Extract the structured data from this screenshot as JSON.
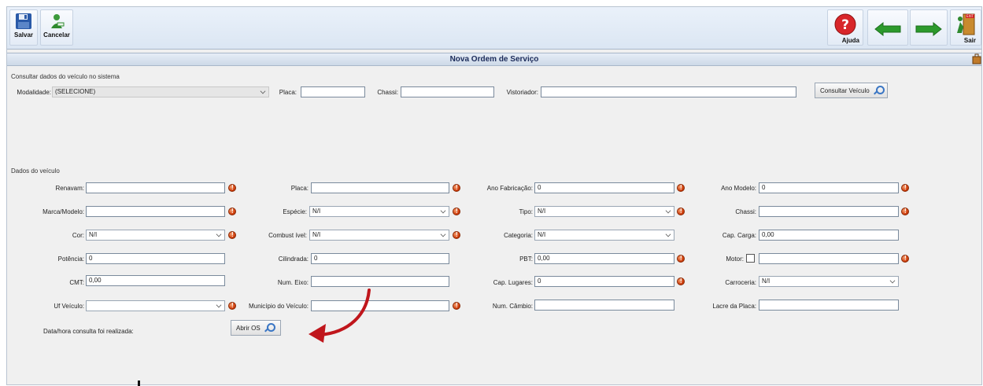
{
  "toolbar": {
    "save_label": "Salvar",
    "cancel_label": "Cancelar",
    "help_label": "Ajuda",
    "exit_label": "Sair",
    "exit_sign": "EXIT"
  },
  "window_title": "Nova Ordem de Serviço",
  "consult": {
    "group_title": "Consultar dados do veículo no sistema",
    "modalidade_label": "Modalidade:",
    "modalidade_value": "(SELECIONE)",
    "placa_label": "Placa:",
    "placa_value": "",
    "chassi_label": "Chassi:",
    "chassi_value": "",
    "vistoriador_label": "Vistoriador:",
    "vistoriador_value": "",
    "button_label": "Consultar Veículo"
  },
  "vehicle": {
    "group_title": "Dados do veículo",
    "renavam_label": "Renavam:",
    "renavam_value": "",
    "placa_label": "Placa:",
    "placa_value": "",
    "ano_fab_label": "Ano Fabricação:",
    "ano_fab_value": "0",
    "ano_modelo_label": "Ano Modelo:",
    "ano_modelo_value": "0",
    "marca_label": "Marca/Modelo:",
    "marca_value": "",
    "especie_label": "Espécie:",
    "especie_value": "N/I",
    "tipo_label": "Tipo:",
    "tipo_value": "N/I",
    "chassi_label": "Chassi:",
    "chassi_value": "",
    "cor_label": "Cor:",
    "cor_value": "N/I",
    "combustivel_label": "Combust ível:",
    "combustivel_value": "N/I",
    "categoria_label": "Categoria:",
    "categoria_value": "N/I",
    "cap_carga_label": "Cap. Carga:",
    "cap_carga_value": "0,00",
    "potencia_label": "Potência:",
    "potencia_value": "0",
    "cilindrada_label": "Cilindrada:",
    "cilindrada_value": "0",
    "pbt_label": "PBT:",
    "pbt_value": "0,00",
    "motor_label": "Motor:",
    "motor_value": "",
    "cmt_label": "CMT:",
    "cmt_value": "0,00",
    "num_eixo_label": "Num. Eixo:",
    "num_eixo_value": "",
    "cap_lugares_label": "Cap. Lugares:",
    "cap_lugares_value": "0",
    "carroceria_label": "Carroceria:",
    "carroceria_value": "N/I",
    "uf_label": "Uf Veículo:",
    "uf_value": "",
    "municipio_label": "Município do Veículo:",
    "municipio_value": "",
    "num_cambio_label": "Num. Câmbio:",
    "num_cambio_value": "",
    "lacre_label": "Lacre da Placa:",
    "lacre_value": "",
    "datahora_label": "Data/hora consulta foi realizada:",
    "abrir_os_label": "Abrir OS"
  },
  "colors": {
    "annotation_arrow": "#c0161c",
    "error_icon": "#d2400e",
    "title_text": "#1b2b5a"
  }
}
